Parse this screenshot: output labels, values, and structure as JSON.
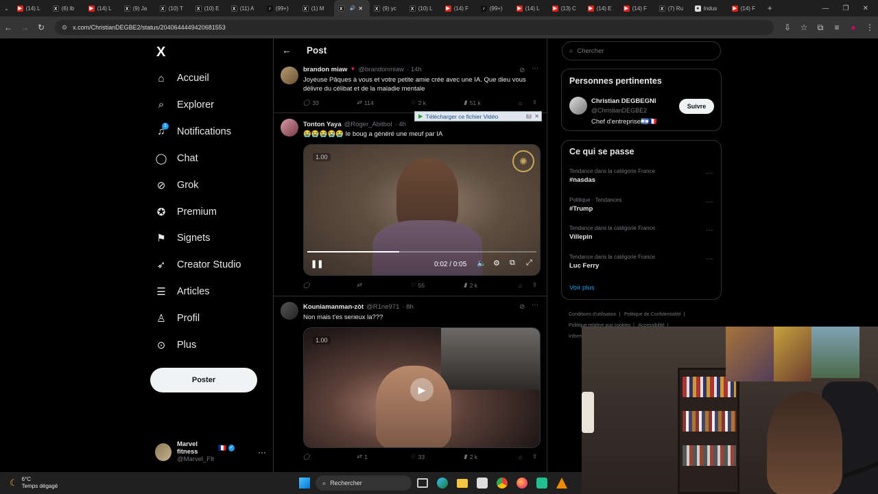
{
  "browser": {
    "tabs": [
      {
        "icon": "youtube",
        "label": "(14) L"
      },
      {
        "icon": "x",
        "label": "(6) lb"
      },
      {
        "icon": "youtube",
        "label": "(14) L"
      },
      {
        "icon": "x",
        "label": "(9) Ja"
      },
      {
        "icon": "x",
        "label": "(10) T"
      },
      {
        "icon": "x",
        "label": "(10) E"
      },
      {
        "icon": "x",
        "label": "(11) A"
      },
      {
        "icon": "tiktok",
        "label": "(99+)"
      },
      {
        "icon": "x",
        "label": "(1) M"
      },
      {
        "icon": "x",
        "label": ""
      },
      {
        "icon": "x",
        "label": "(9) yc"
      },
      {
        "icon": "x",
        "label": "(10) L"
      },
      {
        "icon": "youtube",
        "label": "(14) F"
      },
      {
        "icon": "tiktok",
        "label": "(99+)"
      },
      {
        "icon": "youtube",
        "label": "(14) L"
      },
      {
        "icon": "youtube",
        "label": "(13) C"
      },
      {
        "icon": "youtube",
        "label": "(14) E"
      },
      {
        "icon": "youtube",
        "label": "(14) F"
      },
      {
        "icon": "x",
        "label": "(7) Ru"
      },
      {
        "icon": "generic",
        "label": "Indus"
      },
      {
        "icon": "youtube",
        "label": "(14) F"
      }
    ],
    "url": "x.com/ChristianDEGBE2/status/2040644449420681553"
  },
  "nav": {
    "logo": "X",
    "items": [
      {
        "label": "Accueil",
        "icon": "home-icon"
      },
      {
        "label": "Explorer",
        "icon": "search-icon"
      },
      {
        "label": "Notifications",
        "icon": "bell-icon",
        "badge": "1"
      },
      {
        "label": "Chat",
        "icon": "chat-icon"
      },
      {
        "label": "Grok",
        "icon": "grok-icon"
      },
      {
        "label": "Premium",
        "icon": "premium-icon"
      },
      {
        "label": "Signets",
        "icon": "bookmark-icon"
      },
      {
        "label": "Creator Studio",
        "icon": "rocket-icon"
      },
      {
        "label": "Articles",
        "icon": "article-icon"
      },
      {
        "label": "Profil",
        "icon": "user-icon"
      },
      {
        "label": "Plus",
        "icon": "more-circle-icon"
      }
    ],
    "post_button": "Poster",
    "account": {
      "name": "Marvel fitness",
      "flag": "🇫🇷",
      "handle": "@Marvel_Flt"
    }
  },
  "main": {
    "header_title": "Post",
    "tweets": [
      {
        "name": "brandon miaw",
        "handle": "@brandonmiaw",
        "time": "· 14h",
        "text": "Joyeuse Pâques à vous et votre petite amie crée avec une IA. Que dieu vous délivre du célibat et de la maladie mentale",
        "replies": "33",
        "reposts": "114",
        "likes": "2 k",
        "views": "51 k"
      },
      {
        "name": "Tonton Yaya",
        "handle": "@Roger_Abitbol",
        "time": "· 4h",
        "text": "😭😭😭😭😭 le boug a généré une meuf par IA",
        "video": {
          "speed": "1.00",
          "time": "0:02 / 0:05",
          "progress": 0.4
        },
        "replies": "",
        "reposts": "",
        "likes": "55",
        "views": "2 k"
      },
      {
        "name": "Kouniamanman-zòt",
        "handle": "@R1ne971",
        "time": "· 8h",
        "text": "Non mais t'es serieux la???",
        "video": {
          "speed": "1.00"
        },
        "replies": "",
        "reposts": "1",
        "likes": "33",
        "views": "2 k"
      }
    ],
    "download_bar": "Télécharger ce fichier Vidéo"
  },
  "right": {
    "search_placeholder": "Chercher",
    "relevant_title": "Personnes pertinentes",
    "person": {
      "name": "Christian DEGBEGNI",
      "handle": "@ChristianDEGBE2",
      "bio": "Chef d'entreprise🇮🇱🇫🇷",
      "follow": "Suivre"
    },
    "trends_title": "Ce qui se passe",
    "trends": [
      {
        "context": "Tendance dans la catégorie France",
        "name": "#nasdas"
      },
      {
        "context": "Politique · Tendances",
        "name": "#Trump"
      },
      {
        "context": "Tendance dans la catégorie France",
        "name": "Villepin"
      },
      {
        "context": "Tendance dans la catégorie France",
        "name": "Luc Ferry"
      }
    ],
    "show_more": "Voir plus",
    "footer": [
      "Conditions d'utilisation",
      "Politique de Confidentialité",
      "Politique relative aux cookies",
      "Accessibilité",
      "Inform"
    ]
  },
  "taskbar": {
    "weather_temp": "6°C",
    "weather_desc": "Temps dégagé",
    "search": "Rechercher"
  },
  "colors": {
    "accent": "#1d9bf0",
    "bg": "#000000",
    "border": "#2f3336",
    "muted": "#71767b"
  }
}
